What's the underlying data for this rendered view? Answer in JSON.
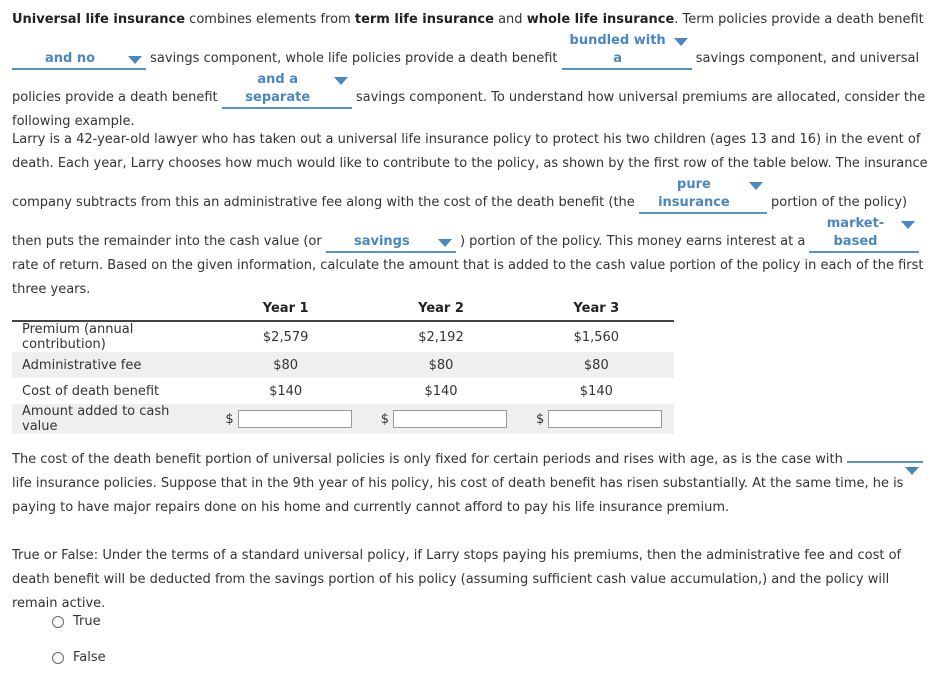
{
  "intro": {
    "bold1": "Universal life insurance",
    "t1": " combines elements from ",
    "bold2": "term life insurance",
    "t2": " and ",
    "bold3": "whole life insurance",
    "t3": ". Term policies provide a death benefit ",
    "dd1": "and no",
    "t4": " savings component, whole life policies provide a death benefit ",
    "dd2": "bundled with a",
    "t5": " savings component, and universal policies provide a death benefit ",
    "dd3": "and a separate",
    "t6": " savings component. To understand how universal premiums are allocated, consider the following example."
  },
  "scenario": {
    "t1": "Larry is a 42-year-old lawyer who has taken out a universal life insurance policy to protect his two children (ages 13 and 16) in the event of death. Each year, Larry chooses how much would like to contribute to the policy, as shown by the first row of the table below. The insurance company subtracts from this an administrative fee along with the cost of the death benefit (the ",
    "dd1": "pure insurance",
    "t2": " portion of the policy) then puts the remainder into the cash value (or ",
    "dd2": "savings",
    "t3": " ) portion of the policy. This money earns interest at a ",
    "dd3": "market-based",
    "t4": " rate of return. Based on the given information, calculate the amount that is added to the cash value portion of the policy in each of the first three years."
  },
  "table": {
    "headers": [
      "",
      "Year 1",
      "Year 2",
      "Year 3"
    ],
    "rows": [
      {
        "label": "Premium (annual contribution)",
        "values": [
          "$2,579",
          "$2,192",
          "$1,560"
        ]
      },
      {
        "label": "Administrative fee",
        "values": [
          "$80",
          "$80",
          "$80"
        ]
      },
      {
        "label": "Cost of death benefit",
        "values": [
          "$140",
          "$140",
          "$140"
        ]
      }
    ],
    "input_row": {
      "label": "Amount added to cash value",
      "currency": "$",
      "values": [
        "",
        "",
        ""
      ]
    }
  },
  "followup": {
    "t1": "The cost of the death benefit portion of universal policies is only fixed for certain periods and rises with age, as is the case with ",
    "dd1": "",
    "t2": " life insurance policies. Suppose that in the 9th year of his policy, his cost of death benefit has risen substantially. At the same time, he is paying to have major repairs done on his home and currently cannot afford to pay his life insurance premium."
  },
  "question": {
    "text": "True or False: Under the terms of a standard universal policy, if Larry stops paying his premiums, then the administrative fee and cost of death benefit will be deducted from the savings portion of his policy (assuming sufficient cash value accumulation,) and the policy will remain active.",
    "options": [
      "True",
      "False"
    ]
  }
}
